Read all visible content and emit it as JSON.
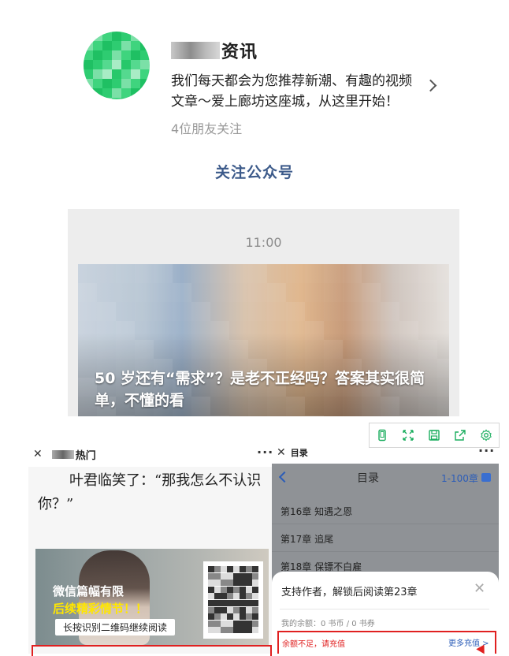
{
  "account": {
    "name_suffix": "资讯",
    "description": "我们每天都会为您推荐新潮、有趣的视频文章～爱上廊坊这座城，从这里开始！",
    "friends_following": "4位朋友关注",
    "follow_button": "关注公众号"
  },
  "article": {
    "time": "11:00",
    "title": "50 岁还有“需求”？是老不正经吗？答案其实很简单，不懂的看"
  },
  "toolbar": {
    "icons": [
      "phone-icon",
      "expand-icon",
      "save-icon",
      "share-icon",
      "settings-icon"
    ]
  },
  "left_panel": {
    "close": "✕",
    "title_suffix": "热门",
    "more": "···",
    "novel_text": "叶君临笑了：“那我怎么不认识你？”",
    "ad": {
      "line1": "微信篇幅有限",
      "line2": "后续精彩情节！！",
      "line3": "长按识别二维码继续阅读"
    }
  },
  "right_panel": {
    "close": "✕",
    "title": "目录",
    "more": "···",
    "bar_title": "目录",
    "range": "1-100章",
    "chapters": [
      "第16章 知遇之恩",
      "第17章 追尾",
      "第18章 保镖不白雇"
    ],
    "sheet": {
      "title": "支持作者，解锁后阅读第23章",
      "close": "✕",
      "balance": "我的余额：0 书币 / 0 书券",
      "insufficient": "余额不足，请充值",
      "more_recharge": "更多充值 >"
    }
  },
  "colors": {
    "link_blue": "#3c5a8a",
    "accent_blue": "#2c5db8",
    "alert_red": "#e02020",
    "toolbar_green": "#1aad5e"
  }
}
